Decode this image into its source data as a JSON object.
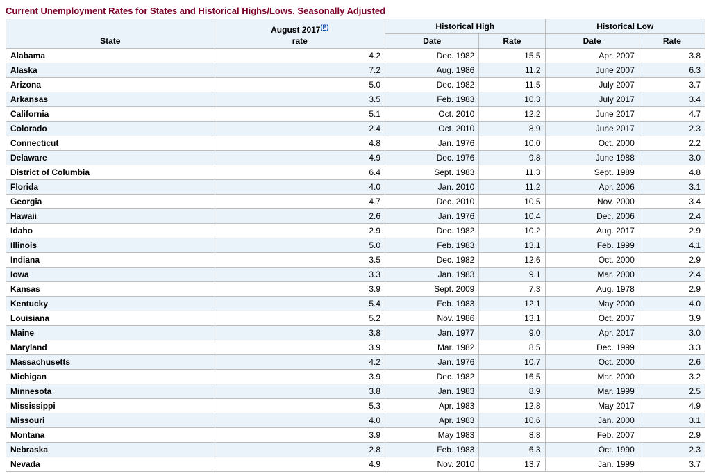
{
  "title": "Current Unemployment Rates for States and Historical Highs/Lows, Seasonally Adjusted",
  "headers": {
    "state": "State",
    "rate_month": "August 2017",
    "rate_footnote": "(P)",
    "rate_sub": "rate",
    "hist_high": "Historical High",
    "hist_low": "Historical Low",
    "date": "Date",
    "rate": "Rate"
  },
  "rows": [
    {
      "state": "Alabama",
      "rate": "4.2",
      "high_date": "Dec. 1982",
      "high_rate": "15.5",
      "low_date": "Apr. 2007",
      "low_rate": "3.8"
    },
    {
      "state": "Alaska",
      "rate": "7.2",
      "high_date": "Aug. 1986",
      "high_rate": "11.2",
      "low_date": "June 2007",
      "low_rate": "6.3"
    },
    {
      "state": "Arizona",
      "rate": "5.0",
      "high_date": "Dec. 1982",
      "high_rate": "11.5",
      "low_date": "July 2007",
      "low_rate": "3.7"
    },
    {
      "state": "Arkansas",
      "rate": "3.5",
      "high_date": "Feb. 1983",
      "high_rate": "10.3",
      "low_date": "July 2017",
      "low_rate": "3.4"
    },
    {
      "state": "California",
      "rate": "5.1",
      "high_date": "Oct. 2010",
      "high_rate": "12.2",
      "low_date": "June 2017",
      "low_rate": "4.7"
    },
    {
      "state": "Colorado",
      "rate": "2.4",
      "high_date": "Oct. 2010",
      "high_rate": "8.9",
      "low_date": "June 2017",
      "low_rate": "2.3"
    },
    {
      "state": "Connecticut",
      "rate": "4.8",
      "high_date": "Jan. 1976",
      "high_rate": "10.0",
      "low_date": "Oct. 2000",
      "low_rate": "2.2"
    },
    {
      "state": "Delaware",
      "rate": "4.9",
      "high_date": "Dec. 1976",
      "high_rate": "9.8",
      "low_date": "June 1988",
      "low_rate": "3.0"
    },
    {
      "state": "District of Columbia",
      "rate": "6.4",
      "high_date": "Sept. 1983",
      "high_rate": "11.3",
      "low_date": "Sept. 1989",
      "low_rate": "4.8"
    },
    {
      "state": "Florida",
      "rate": "4.0",
      "high_date": "Jan. 2010",
      "high_rate": "11.2",
      "low_date": "Apr. 2006",
      "low_rate": "3.1"
    },
    {
      "state": "Georgia",
      "rate": "4.7",
      "high_date": "Dec. 2010",
      "high_rate": "10.5",
      "low_date": "Nov. 2000",
      "low_rate": "3.4"
    },
    {
      "state": "Hawaii",
      "rate": "2.6",
      "high_date": "Jan. 1976",
      "high_rate": "10.4",
      "low_date": "Dec. 2006",
      "low_rate": "2.4"
    },
    {
      "state": "Idaho",
      "rate": "2.9",
      "high_date": "Dec. 1982",
      "high_rate": "10.2",
      "low_date": "Aug. 2017",
      "low_rate": "2.9"
    },
    {
      "state": "Illinois",
      "rate": "5.0",
      "high_date": "Feb. 1983",
      "high_rate": "13.1",
      "low_date": "Feb. 1999",
      "low_rate": "4.1"
    },
    {
      "state": "Indiana",
      "rate": "3.5",
      "high_date": "Dec. 1982",
      "high_rate": "12.6",
      "low_date": "Oct. 2000",
      "low_rate": "2.9"
    },
    {
      "state": "Iowa",
      "rate": "3.3",
      "high_date": "Jan. 1983",
      "high_rate": "9.1",
      "low_date": "Mar. 2000",
      "low_rate": "2.4"
    },
    {
      "state": "Kansas",
      "rate": "3.9",
      "high_date": "Sept. 2009",
      "high_rate": "7.3",
      "low_date": "Aug. 1978",
      "low_rate": "2.9"
    },
    {
      "state": "Kentucky",
      "rate": "5.4",
      "high_date": "Feb. 1983",
      "high_rate": "12.1",
      "low_date": "May 2000",
      "low_rate": "4.0"
    },
    {
      "state": "Louisiana",
      "rate": "5.2",
      "high_date": "Nov. 1986",
      "high_rate": "13.1",
      "low_date": "Oct. 2007",
      "low_rate": "3.9"
    },
    {
      "state": "Maine",
      "rate": "3.8",
      "high_date": "Jan. 1977",
      "high_rate": "9.0",
      "low_date": "Apr. 2017",
      "low_rate": "3.0"
    },
    {
      "state": "Maryland",
      "rate": "3.9",
      "high_date": "Mar. 1982",
      "high_rate": "8.5",
      "low_date": "Dec. 1999",
      "low_rate": "3.3"
    },
    {
      "state": "Massachusetts",
      "rate": "4.2",
      "high_date": "Jan. 1976",
      "high_rate": "10.7",
      "low_date": "Oct. 2000",
      "low_rate": "2.6"
    },
    {
      "state": "Michigan",
      "rate": "3.9",
      "high_date": "Dec. 1982",
      "high_rate": "16.5",
      "low_date": "Mar. 2000",
      "low_rate": "3.2"
    },
    {
      "state": "Minnesota",
      "rate": "3.8",
      "high_date": "Jan. 1983",
      "high_rate": "8.9",
      "low_date": "Mar. 1999",
      "low_rate": "2.5"
    },
    {
      "state": "Mississippi",
      "rate": "5.3",
      "high_date": "Apr. 1983",
      "high_rate": "12.8",
      "low_date": "May 2017",
      "low_rate": "4.9"
    },
    {
      "state": "Missouri",
      "rate": "4.0",
      "high_date": "Apr. 1983",
      "high_rate": "10.6",
      "low_date": "Jan. 2000",
      "low_rate": "3.1"
    },
    {
      "state": "Montana",
      "rate": "3.9",
      "high_date": "May 1983",
      "high_rate": "8.8",
      "low_date": "Feb. 2007",
      "low_rate": "2.9"
    },
    {
      "state": "Nebraska",
      "rate": "2.8",
      "high_date": "Feb. 1983",
      "high_rate": "6.3",
      "low_date": "Oct. 1990",
      "low_rate": "2.3"
    },
    {
      "state": "Nevada",
      "rate": "4.9",
      "high_date": "Nov. 2010",
      "high_rate": "13.7",
      "low_date": "Jan. 1999",
      "low_rate": "3.7"
    }
  ]
}
